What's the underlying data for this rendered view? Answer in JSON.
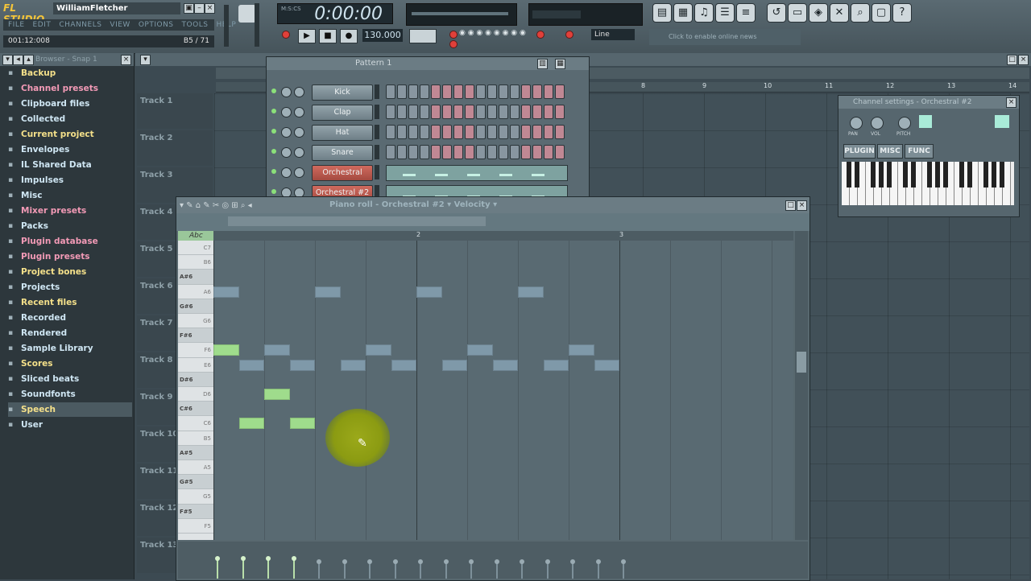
{
  "app": {
    "logo": "FL STUDIO",
    "user": "WilliamFletcher"
  },
  "menu": [
    "FILE",
    "EDIT",
    "CHANNELS",
    "VIEW",
    "OPTIONS",
    "TOOLS",
    "HELP"
  ],
  "hint": {
    "left": "001:12:008",
    "right": "B5 / 71"
  },
  "transport": {
    "time": "0:00:00",
    "time_sub": "M:S:CS",
    "tempo": "130.000",
    "line_mode": "Line",
    "song_hint": "Click to enable online news"
  },
  "browser": {
    "title": "Browser - Snap 1",
    "items": [
      {
        "label": "Backup",
        "color": "#f4e08a"
      },
      {
        "label": "Channel presets",
        "color": "#f29ab6"
      },
      {
        "label": "Clipboard files",
        "color": "#cfe6f3"
      },
      {
        "label": "Collected",
        "color": "#cfe6f3"
      },
      {
        "label": "Current project",
        "color": "#f4e08a"
      },
      {
        "label": "Envelopes",
        "color": "#cfe6f3"
      },
      {
        "label": "IL Shared Data",
        "color": "#cfe6f3"
      },
      {
        "label": "Impulses",
        "color": "#cfe6f3"
      },
      {
        "label": "Misc",
        "color": "#cfe6f3"
      },
      {
        "label": "Mixer presets",
        "color": "#f29ab6"
      },
      {
        "label": "Packs",
        "color": "#cfe6f3"
      },
      {
        "label": "Plugin database",
        "color": "#f29ab6"
      },
      {
        "label": "Plugin presets",
        "color": "#f29ab6"
      },
      {
        "label": "Project bones",
        "color": "#f4e08a"
      },
      {
        "label": "Projects",
        "color": "#cfe6f3"
      },
      {
        "label": "Recent files",
        "color": "#f4e08a"
      },
      {
        "label": "Recorded",
        "color": "#cfe6f3"
      },
      {
        "label": "Rendered",
        "color": "#cfe6f3"
      },
      {
        "label": "Sample Library",
        "color": "#cfe6f3"
      },
      {
        "label": "Scores",
        "color": "#f4e08a"
      },
      {
        "label": "Sliced beats",
        "color": "#cfe6f3"
      },
      {
        "label": "Soundfonts",
        "color": "#cfe6f3"
      },
      {
        "label": "Speech",
        "color": "#f4e08a"
      },
      {
        "label": "User",
        "color": "#cfe6f3"
      }
    ]
  },
  "playlist": {
    "ruler": [
      "8",
      "9",
      "10",
      "11",
      "12",
      "13",
      "14"
    ],
    "tracks": [
      "Track 1",
      "Track 2",
      "Track 3",
      "Track 4",
      "Track 5",
      "Track 6",
      "Track 7",
      "Track 8",
      "Track 9",
      "Track 10",
      "Track 11",
      "Track 12",
      "Track 13"
    ]
  },
  "step_sequencer": {
    "title": "Pattern 1",
    "channels": [
      {
        "name": "Kick",
        "type": "steps"
      },
      {
        "name": "Clap",
        "type": "steps"
      },
      {
        "name": "Hat",
        "type": "steps"
      },
      {
        "name": "Snare",
        "type": "steps"
      },
      {
        "name": "Orchestral",
        "type": "roll"
      },
      {
        "name": "Orchestral #2",
        "type": "roll"
      }
    ]
  },
  "channel_settings": {
    "title": "Channel settings - Orchestral #2",
    "knobs": [
      "PAN",
      "VOL",
      "PITCH"
    ],
    "tabs": [
      "PLUGIN",
      "MISC",
      "FUNC"
    ]
  },
  "piano_roll": {
    "title": "Piano roll - Orchestral #2",
    "target": "Velocity",
    "ruler": [
      "2",
      "3"
    ],
    "keys": [
      "C7",
      "B6",
      "A#6",
      "A6",
      "G#6",
      "G6",
      "F#6",
      "F6",
      "E6",
      "D#6",
      "D6",
      "C#6",
      "C6",
      "B5",
      "A#5",
      "A5",
      "G#5",
      "G5",
      "F#5",
      "F5"
    ],
    "notes": [
      {
        "start": 0,
        "key": 3,
        "len": 0.5,
        "color": "blue"
      },
      {
        "start": 2,
        "key": 3,
        "len": 0.5,
        "color": "blue"
      },
      {
        "start": 4,
        "key": 3,
        "len": 0.5,
        "color": "blue"
      },
      {
        "start": 6,
        "key": 3,
        "len": 0.5,
        "color": "blue"
      },
      {
        "start": 0,
        "key": 7,
        "len": 0.5,
        "color": "green"
      },
      {
        "start": 1,
        "key": 7,
        "len": 0.5,
        "color": "blue"
      },
      {
        "start": 3,
        "key": 7,
        "len": 0.5,
        "color": "blue"
      },
      {
        "start": 5,
        "key": 7,
        "len": 0.5,
        "color": "blue"
      },
      {
        "start": 7,
        "key": 7,
        "len": 0.5,
        "color": "blue"
      },
      {
        "start": 0.5,
        "key": 8,
        "len": 0.5,
        "color": "blue"
      },
      {
        "start": 1.5,
        "key": 8,
        "len": 0.5,
        "color": "blue"
      },
      {
        "start": 2.5,
        "key": 8,
        "len": 0.5,
        "color": "blue"
      },
      {
        "start": 3.5,
        "key": 8,
        "len": 0.5,
        "color": "blue"
      },
      {
        "start": 4.5,
        "key": 8,
        "len": 0.5,
        "color": "blue"
      },
      {
        "start": 5.5,
        "key": 8,
        "len": 0.5,
        "color": "blue"
      },
      {
        "start": 6.5,
        "key": 8,
        "len": 0.5,
        "color": "blue"
      },
      {
        "start": 7.5,
        "key": 8,
        "len": 0.5,
        "color": "blue"
      },
      {
        "start": 1,
        "key": 10,
        "len": 0.5,
        "color": "green"
      },
      {
        "start": 0.5,
        "key": 12,
        "len": 0.5,
        "color": "green"
      },
      {
        "start": 1.5,
        "key": 12,
        "len": 0.5,
        "color": "green"
      }
    ],
    "velocity_count": 17
  }
}
